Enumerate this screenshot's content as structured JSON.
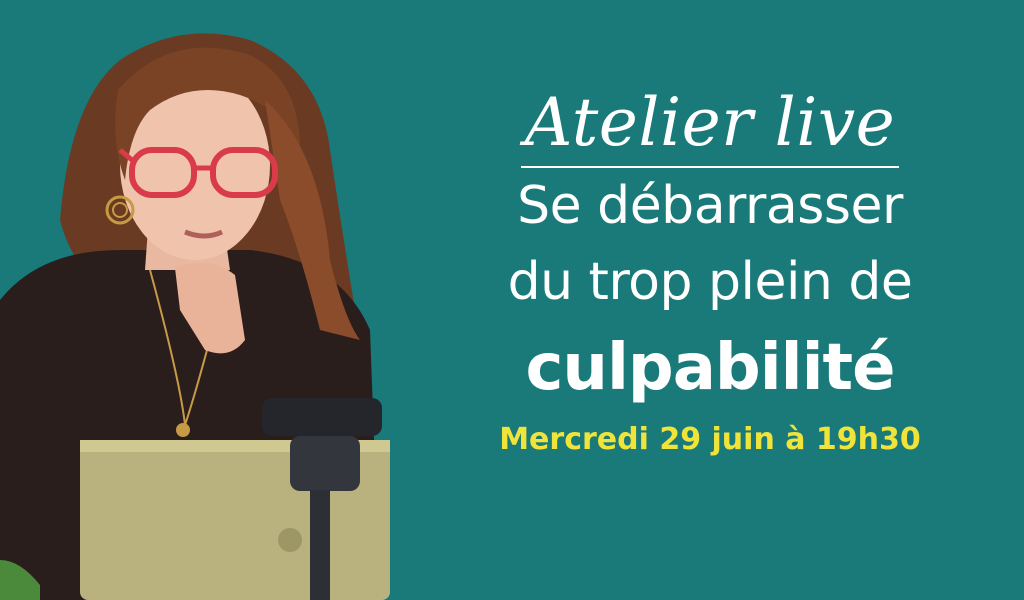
{
  "banner": {
    "kicker": "Atelier live",
    "title_line_1": "Se débarrasser",
    "title_line_2": "du trop plein de",
    "title_line_3": "culpabilité",
    "date": "Mercredi 29 juin à 19h30"
  },
  "colors": {
    "background": "#1a7a7a",
    "text": "#ffffff",
    "date_text": "#f0e43a"
  },
  "photo": {
    "subject": "woman-with-red-glasses-at-laptop"
  }
}
